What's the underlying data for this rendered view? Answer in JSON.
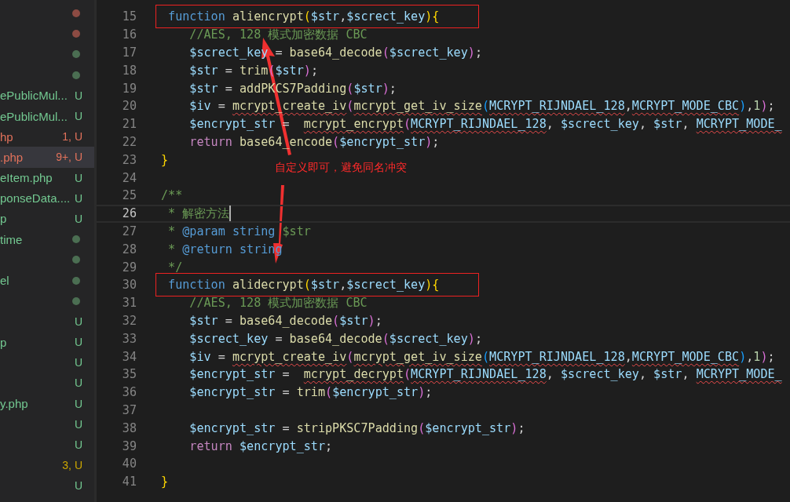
{
  "explorer": {
    "items": [
      {
        "kind": "dot",
        "color": "#8c4b43",
        "selected": false
      },
      {
        "kind": "dot",
        "color": "#8c4b43",
        "selected": false
      },
      {
        "kind": "dot",
        "color": "#4b6e52",
        "selected": false
      },
      {
        "kind": "dot",
        "color": "#4b6e52",
        "selected": false
      },
      {
        "label": "ePublicMul...",
        "kind": "badge",
        "badge": "U",
        "color": "#73c991",
        "selected": false
      },
      {
        "label": "ePublicMul...",
        "kind": "badge",
        "badge": "U",
        "color": "#73c991",
        "selected": false
      },
      {
        "label": "hp",
        "kind": "badge",
        "badge": "1, U",
        "color": "#e2725b",
        "selected": false
      },
      {
        "label": ".php",
        "kind": "badge",
        "badge": "9+, U",
        "color": "#e2725b",
        "selected": true
      },
      {
        "label": "eItem.php",
        "kind": "badge",
        "badge": "U",
        "color": "#73c991",
        "selected": false
      },
      {
        "label": "ponseData....",
        "kind": "badge",
        "badge": "U",
        "color": "#73c991",
        "selected": false
      },
      {
        "label": "p",
        "kind": "badge",
        "badge": "U",
        "color": "#73c991",
        "selected": false
      },
      {
        "label": "time",
        "kind": "dot",
        "color": "#4b6e52",
        "selected": false
      },
      {
        "kind": "dot",
        "color": "#4b6e52",
        "selected": false
      },
      {
        "label": "el",
        "kind": "dot",
        "color": "#4b6e52",
        "selected": false
      },
      {
        "kind": "dot",
        "color": "#4b6e52",
        "selected": false
      },
      {
        "kind": "badge",
        "badge": "U",
        "color": "#73c991",
        "selected": false
      },
      {
        "label": "p",
        "kind": "badge",
        "badge": "U",
        "color": "#73c991",
        "selected": false
      },
      {
        "kind": "badge",
        "badge": "U",
        "color": "#73c991",
        "selected": false
      },
      {
        "kind": "badge",
        "badge": "U",
        "color": "#73c991",
        "selected": false
      },
      {
        "label": "y.php",
        "kind": "badge",
        "badge": "U",
        "color": "#73c991",
        "selected": false
      },
      {
        "kind": "badge",
        "badge": "U",
        "color": "#73c991",
        "selected": false
      },
      {
        "kind": "badge",
        "badge": "U",
        "color": "#73c991",
        "selected": false
      },
      {
        "kind": "badge",
        "badge": "3, U",
        "color": "#cca700",
        "selected": false
      },
      {
        "kind": "badge",
        "badge": "U",
        "color": "#73c991",
        "selected": false
      }
    ]
  },
  "editor": {
    "lines": [
      {
        "number": "15",
        "current": false,
        "boxed": true,
        "tokens": [
          {
            "kind": "keyword",
            "text": " function"
          },
          {
            "kind": "function",
            "text": " aliencrypt"
          },
          {
            "kind": "bracket-1",
            "text": "("
          },
          {
            "kind": "variable",
            "text": "$str"
          },
          {
            "kind": "plain",
            "text": ","
          },
          {
            "kind": "variable",
            "text": "$screct_key"
          },
          {
            "kind": "bracket-1",
            "text": "){"
          }
        ]
      },
      {
        "number": "16",
        "current": false,
        "tokens": [
          {
            "kind": "comment",
            "text": "    //AES, 128 模式加密数据 CBC"
          }
        ]
      },
      {
        "number": "17",
        "current": false,
        "tokens": [
          {
            "kind": "variable",
            "text": "    $screct_key"
          },
          {
            "kind": "plain",
            "text": " = "
          },
          {
            "kind": "function",
            "text": "base64_decode"
          },
          {
            "kind": "bracket-2",
            "text": "("
          },
          {
            "kind": "variable",
            "text": "$screct_key"
          },
          {
            "kind": "bracket-2",
            "text": ")"
          },
          {
            "kind": "plain",
            "text": ";"
          }
        ]
      },
      {
        "number": "18",
        "current": false,
        "tokens": [
          {
            "kind": "variable",
            "text": "    $str"
          },
          {
            "kind": "plain",
            "text": " = "
          },
          {
            "kind": "function",
            "text": "trim"
          },
          {
            "kind": "bracket-2",
            "text": "("
          },
          {
            "kind": "variable",
            "text": "$str"
          },
          {
            "kind": "bracket-2",
            "text": ")"
          },
          {
            "kind": "plain",
            "text": ";"
          }
        ]
      },
      {
        "number": "19",
        "current": false,
        "tokens": [
          {
            "kind": "variable",
            "text": "    $str"
          },
          {
            "kind": "plain",
            "text": " = "
          },
          {
            "kind": "function",
            "text": "addPKCS7Padding"
          },
          {
            "kind": "bracket-2",
            "text": "("
          },
          {
            "kind": "variable",
            "text": "$str"
          },
          {
            "kind": "bracket-2",
            "text": ")"
          },
          {
            "kind": "plain",
            "text": ";"
          }
        ]
      },
      {
        "number": "20",
        "current": false,
        "tokens": [
          {
            "kind": "variable",
            "text": "    $iv"
          },
          {
            "kind": "plain",
            "text": " = "
          },
          {
            "kind": "function",
            "text": "mcrypt_create_iv",
            "error": true
          },
          {
            "kind": "bracket-2",
            "text": "("
          },
          {
            "kind": "function",
            "text": "mcrypt_get_iv_size",
            "error": true
          },
          {
            "kind": "bracket-3",
            "text": "("
          },
          {
            "kind": "variable",
            "text": "MCRYPT_RIJNDAEL_128",
            "error": true
          },
          {
            "kind": "plain",
            "text": ","
          },
          {
            "kind": "variable",
            "text": "MCRYPT_MODE_CBC",
            "error": true
          },
          {
            "kind": "bracket-3",
            "text": ")"
          },
          {
            "kind": "plain",
            "text": ","
          },
          {
            "kind": "number",
            "text": "1"
          },
          {
            "kind": "bracket-2",
            "text": ")"
          },
          {
            "kind": "plain",
            "text": ";"
          }
        ]
      },
      {
        "number": "21",
        "current": false,
        "tokens": [
          {
            "kind": "variable",
            "text": "    $encrypt_str"
          },
          {
            "kind": "plain",
            "text": " =  "
          },
          {
            "kind": "function",
            "text": "mcrypt_encrypt",
            "error": true
          },
          {
            "kind": "bracket-2",
            "text": "("
          },
          {
            "kind": "variable",
            "text": "MCRYPT_RIJNDAEL_128",
            "error": true
          },
          {
            "kind": "plain",
            "text": ", "
          },
          {
            "kind": "variable",
            "text": "$screct_key"
          },
          {
            "kind": "plain",
            "text": ", "
          },
          {
            "kind": "variable",
            "text": "$str"
          },
          {
            "kind": "plain",
            "text": ", "
          },
          {
            "kind": "variable",
            "text": "MCRYPT_MODE_",
            "error": true
          }
        ]
      },
      {
        "number": "22",
        "current": false,
        "tokens": [
          {
            "kind": "control",
            "text": "    return"
          },
          {
            "kind": "function",
            "text": " base64_encode"
          },
          {
            "kind": "bracket-2",
            "text": "("
          },
          {
            "kind": "variable",
            "text": "$encrypt_str"
          },
          {
            "kind": "bracket-2",
            "text": ")"
          },
          {
            "kind": "plain",
            "text": ";"
          }
        ]
      },
      {
        "number": "23",
        "current": false,
        "tokens": [
          {
            "kind": "bracket-1",
            "text": "}"
          }
        ]
      },
      {
        "number": "24",
        "current": false
      },
      {
        "number": "25",
        "current": false,
        "tokens": [
          {
            "kind": "comment",
            "text": "/**"
          }
        ]
      },
      {
        "number": "26",
        "current": true,
        "tokens": [
          {
            "kind": "comment",
            "text": " * 解密方法"
          }
        ]
      },
      {
        "number": "27",
        "current": false,
        "tokens": [
          {
            "kind": "comment",
            "text": " * "
          },
          {
            "kind": "doc-tag",
            "text": "@param"
          },
          {
            "kind": "doc-tag",
            "text": " string"
          },
          {
            "kind": "comment",
            "text": " $str"
          }
        ]
      },
      {
        "number": "28",
        "current": false,
        "tokens": [
          {
            "kind": "comment",
            "text": " * "
          },
          {
            "kind": "doc-tag",
            "text": "@return"
          },
          {
            "kind": "doc-tag",
            "text": " string"
          }
        ]
      },
      {
        "number": "29",
        "current": false,
        "tokens": [
          {
            "kind": "comment",
            "text": " */"
          }
        ]
      },
      {
        "number": "30",
        "current": false,
        "boxed": true,
        "tokens": [
          {
            "kind": "keyword",
            "text": " function"
          },
          {
            "kind": "function",
            "text": " alidecrypt"
          },
          {
            "kind": "bracket-1",
            "text": "("
          },
          {
            "kind": "variable",
            "text": "$str"
          },
          {
            "kind": "plain",
            "text": ","
          },
          {
            "kind": "variable",
            "text": "$screct_key"
          },
          {
            "kind": "bracket-1",
            "text": "){"
          }
        ]
      },
      {
        "number": "31",
        "current": false,
        "tokens": [
          {
            "kind": "comment",
            "text": "    //AES, 128 模式加密数据 CBC"
          }
        ]
      },
      {
        "number": "32",
        "current": false,
        "tokens": [
          {
            "kind": "variable",
            "text": "    $str"
          },
          {
            "kind": "plain",
            "text": " = "
          },
          {
            "kind": "function",
            "text": "base64_decode"
          },
          {
            "kind": "bracket-2",
            "text": "("
          },
          {
            "kind": "variable",
            "text": "$str"
          },
          {
            "kind": "bracket-2",
            "text": ")"
          },
          {
            "kind": "plain",
            "text": ";"
          }
        ]
      },
      {
        "number": "33",
        "current": false,
        "tokens": [
          {
            "kind": "variable",
            "text": "    $screct_key"
          },
          {
            "kind": "plain",
            "text": " = "
          },
          {
            "kind": "function",
            "text": "base64_decode"
          },
          {
            "kind": "bracket-2",
            "text": "("
          },
          {
            "kind": "variable",
            "text": "$screct_key"
          },
          {
            "kind": "bracket-2",
            "text": ")"
          },
          {
            "kind": "plain",
            "text": ";"
          }
        ]
      },
      {
        "number": "34",
        "current": false,
        "tokens": [
          {
            "kind": "variable",
            "text": "    $iv"
          },
          {
            "kind": "plain",
            "text": " = "
          },
          {
            "kind": "function",
            "text": "mcrypt_create_iv",
            "error": true
          },
          {
            "kind": "bracket-2",
            "text": "("
          },
          {
            "kind": "function",
            "text": "mcrypt_get_iv_size",
            "error": true
          },
          {
            "kind": "bracket-3",
            "text": "("
          },
          {
            "kind": "variable",
            "text": "MCRYPT_RIJNDAEL_128",
            "error": true
          },
          {
            "kind": "plain",
            "text": ","
          },
          {
            "kind": "variable",
            "text": "MCRYPT_MODE_CBC",
            "error": true
          },
          {
            "kind": "bracket-3",
            "text": ")"
          },
          {
            "kind": "plain",
            "text": ","
          },
          {
            "kind": "number",
            "text": "1"
          },
          {
            "kind": "bracket-2",
            "text": ")"
          },
          {
            "kind": "plain",
            "text": ";"
          }
        ]
      },
      {
        "number": "35",
        "current": false,
        "tokens": [
          {
            "kind": "variable",
            "text": "    $encrypt_str"
          },
          {
            "kind": "plain",
            "text": " =  "
          },
          {
            "kind": "function",
            "text": "mcrypt_decrypt",
            "error": true
          },
          {
            "kind": "bracket-2",
            "text": "("
          },
          {
            "kind": "variable",
            "text": "MCRYPT_RIJNDAEL_128",
            "error": true
          },
          {
            "kind": "plain",
            "text": ", "
          },
          {
            "kind": "variable",
            "text": "$screct_key"
          },
          {
            "kind": "plain",
            "text": ", "
          },
          {
            "kind": "variable",
            "text": "$str"
          },
          {
            "kind": "plain",
            "text": ", "
          },
          {
            "kind": "variable",
            "text": "MCRYPT_MODE_",
            "error": true
          }
        ]
      },
      {
        "number": "36",
        "current": false,
        "tokens": [
          {
            "kind": "variable",
            "text": "    $encrypt_str"
          },
          {
            "kind": "plain",
            "text": " = "
          },
          {
            "kind": "function",
            "text": "trim"
          },
          {
            "kind": "bracket-2",
            "text": "("
          },
          {
            "kind": "variable",
            "text": "$encrypt_str"
          },
          {
            "kind": "bracket-2",
            "text": ")"
          },
          {
            "kind": "plain",
            "text": ";"
          }
        ]
      },
      {
        "number": "37",
        "current": false
      },
      {
        "number": "38",
        "current": false,
        "tokens": [
          {
            "kind": "variable",
            "text": "    $encrypt_str"
          },
          {
            "kind": "plain",
            "text": " = "
          },
          {
            "kind": "function",
            "text": "stripPKSC7Padding"
          },
          {
            "kind": "bracket-2",
            "text": "("
          },
          {
            "kind": "variable",
            "text": "$encrypt_str"
          },
          {
            "kind": "bracket-2",
            "text": ")"
          },
          {
            "kind": "plain",
            "text": ";"
          }
        ]
      },
      {
        "number": "39",
        "current": false,
        "tokens": [
          {
            "kind": "control",
            "text": "    return"
          },
          {
            "kind": "variable",
            "text": " $encrypt_str"
          },
          {
            "kind": "plain",
            "text": ";"
          }
        ]
      },
      {
        "number": "40",
        "current": false
      },
      {
        "number": "41",
        "current": false,
        "tokens": [
          {
            "kind": "bracket-1",
            "text": "}"
          }
        ]
      }
    ]
  },
  "annotation": {
    "note": "自定义即可，避免同名冲突"
  }
}
